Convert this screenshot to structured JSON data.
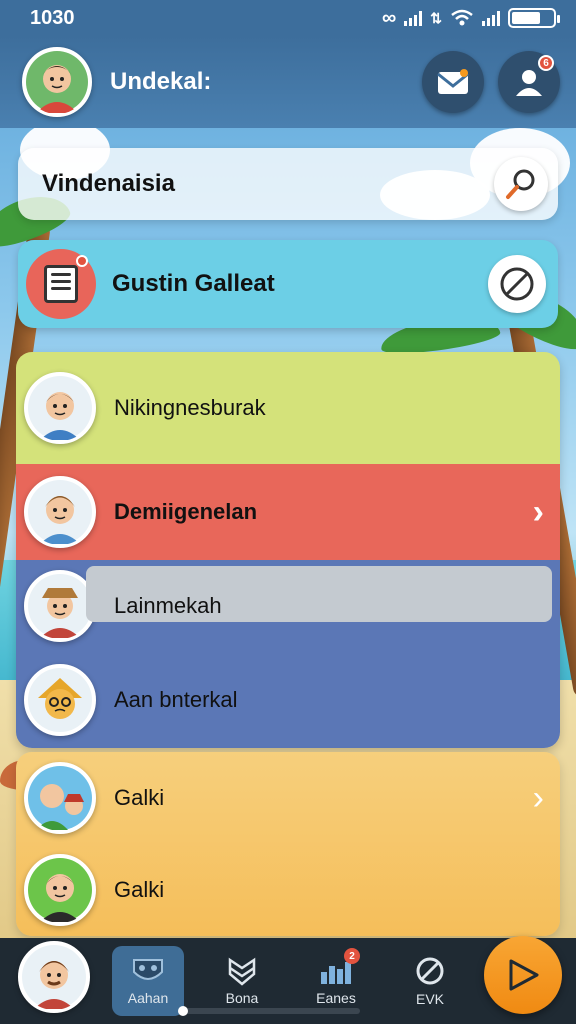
{
  "status_bar": {
    "time": "1030"
  },
  "header": {
    "title": "Undekal:",
    "mail_icon": "mail-icon",
    "profile_icon": "profile-icon",
    "profile_badge": "6"
  },
  "search": {
    "text": "Vindenaisia",
    "button_icon": "search-icon"
  },
  "featured": {
    "title": "Gustin Galleat",
    "icon": "notes-icon",
    "action_icon": "compass-icon"
  },
  "list": {
    "items": [
      {
        "label": "Nikingnesburak",
        "color": "#d4e27a",
        "chevron": ""
      },
      {
        "label": "Demiigenelan",
        "color": "#e8675a",
        "chevron": "›"
      },
      {
        "label": "Lainmekah",
        "color": "#c4cad0",
        "chevron": ""
      },
      {
        "label": "Aan bnterkal",
        "color": "#5b77b6",
        "chevron": ""
      }
    ]
  },
  "list2": {
    "items": [
      {
        "label": "Galki",
        "chevron": "›"
      },
      {
        "label": "Galki",
        "chevron": ""
      }
    ]
  },
  "bottom_nav": {
    "items": [
      {
        "label": "Aahan",
        "icon": "mask-icon"
      },
      {
        "label": "Bona",
        "icon": "shield-icon"
      },
      {
        "label": "Eanes",
        "icon": "chart-icon",
        "badge": "2"
      },
      {
        "label": "EVK",
        "icon": "block-icon"
      }
    ],
    "fab_icon": "play-icon"
  },
  "colors": {
    "header": "#3d6e9c",
    "fab": "#f59a1f",
    "nav_bg": "#1f2a33"
  }
}
